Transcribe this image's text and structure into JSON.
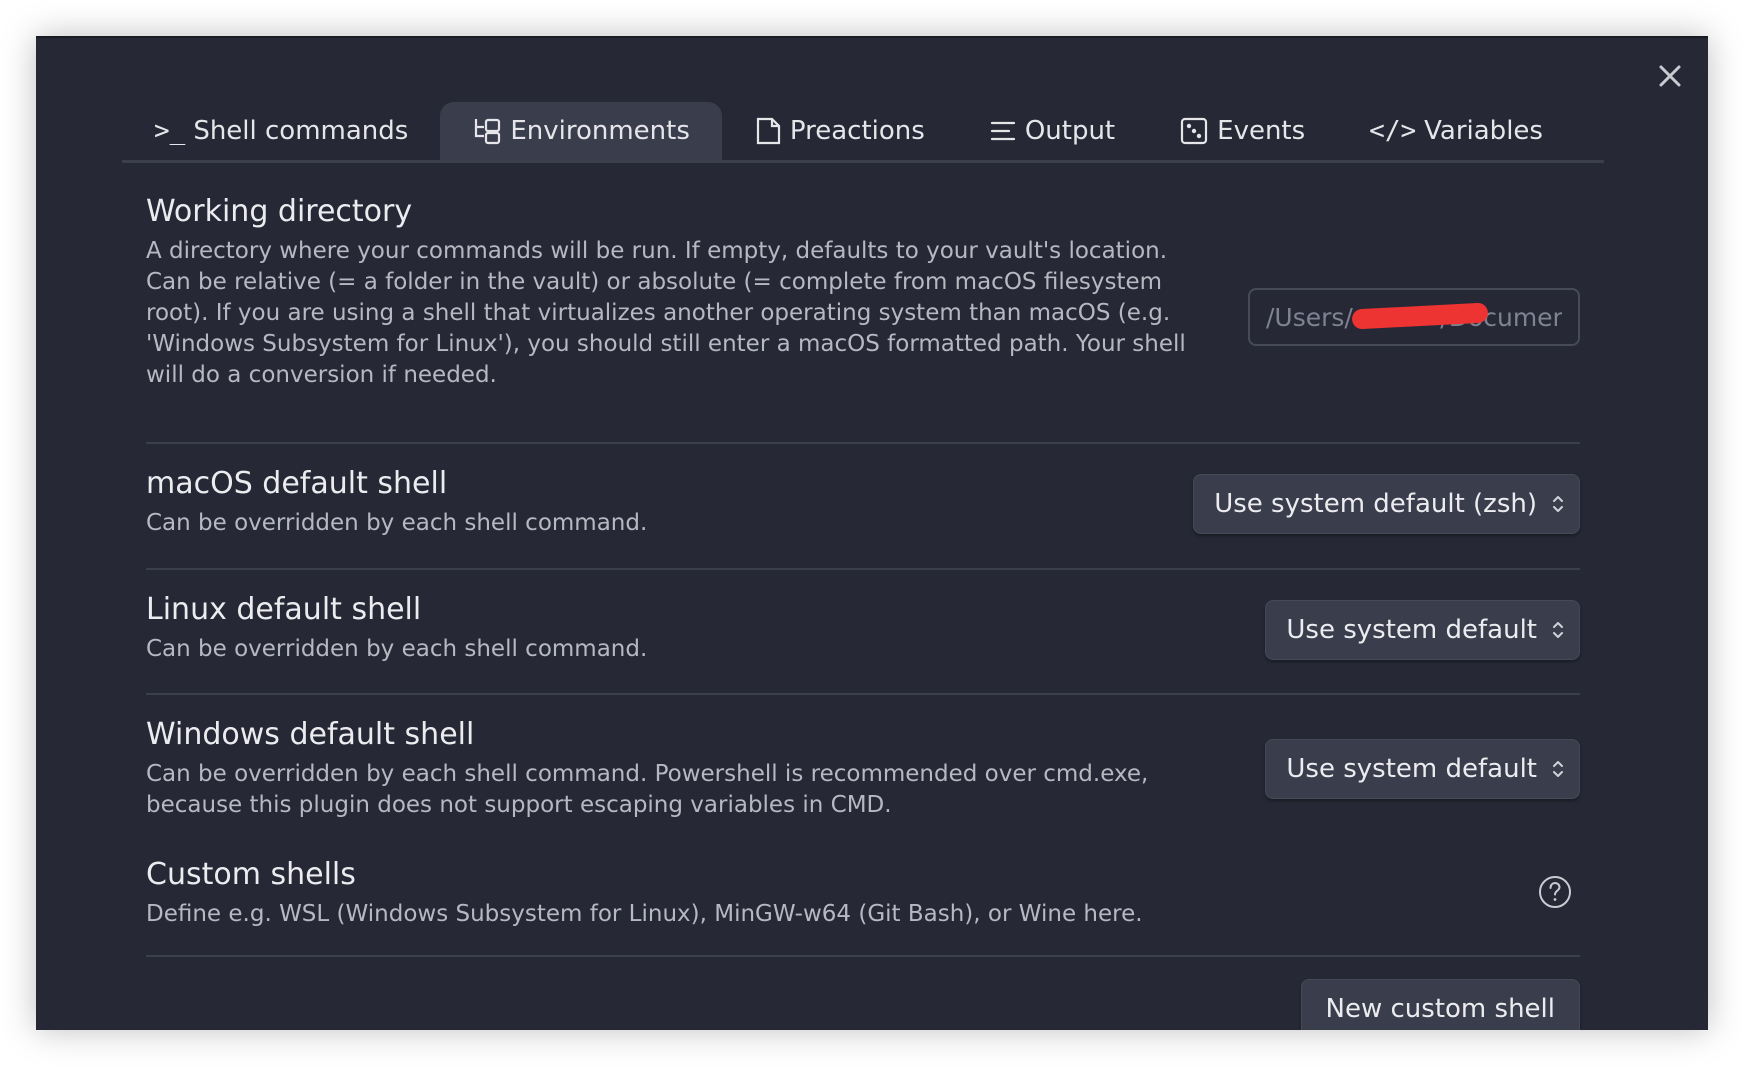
{
  "close": {
    "icon": "close-icon"
  },
  "tabs": [
    {
      "label": "Shell commands",
      "icon": "terminal-icon",
      "active": false
    },
    {
      "label": "Environments",
      "icon": "tree-icon",
      "active": true
    },
    {
      "label": "Preactions",
      "icon": "document-icon",
      "active": false
    },
    {
      "label": "Output",
      "icon": "lines-icon",
      "active": false
    },
    {
      "label": "Events",
      "icon": "dice-icon",
      "active": false
    },
    {
      "label": "Variables",
      "icon": "code-icon",
      "active": false
    }
  ],
  "working_directory": {
    "name": "Working directory",
    "description": "A directory where your commands will be run. If empty, defaults to your vault's location. Can be relative (= a folder in the vault) or absolute (= complete from macOS filesystem root). If you are using a shell that virtualizes another operating system than macOS (e.g. 'Windows Subsystem for Linux'), you should still enter a macOS formatted path. Your shell will do a conversion if needed.",
    "value": "/Users/           /Documents"
  },
  "macos_shell": {
    "name": "macOS default shell",
    "description": "Can be overridden by each shell command.",
    "selected": "Use system default (zsh)"
  },
  "linux_shell": {
    "name": "Linux default shell",
    "description": "Can be overridden by each shell command.",
    "selected": "Use system default"
  },
  "windows_shell": {
    "name": "Windows default shell",
    "description": "Can be overridden by each shell command. Powershell is recommended over cmd.exe, because this plugin does not support escaping variables in CMD.",
    "selected": "Use system default"
  },
  "custom_shells": {
    "name": "Custom shells",
    "description": "Define e.g. WSL (Windows Subsystem for Linux), MinGW-w64 (Git Bash), or Wine here.",
    "help_icon": "question-circle-icon",
    "button_label": "New custom shell"
  },
  "colors": {
    "background": "#262935",
    "surface": "#3a3e4c",
    "text": "#ececf0",
    "muted_text": "#b6b8c2",
    "divider": "#3b3f4d",
    "redaction": "#ee3333"
  }
}
